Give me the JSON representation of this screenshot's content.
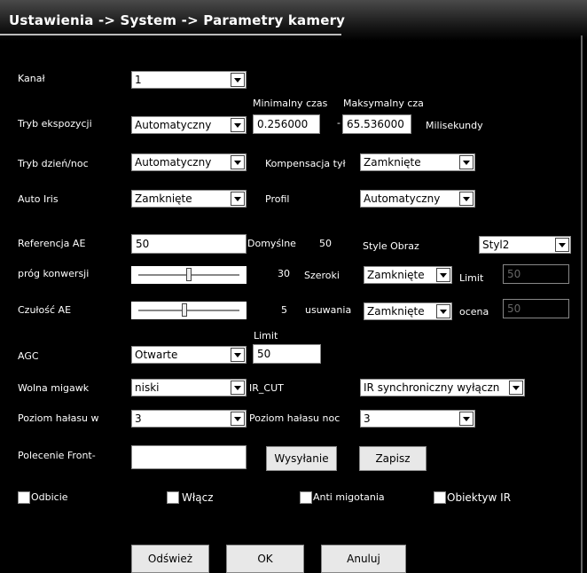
{
  "title": "Ustawienia -> System -> Parametry kamery",
  "labels": {
    "kanal": "Kanał",
    "tryb_ekspozycji": "Tryb ekspozycji",
    "min_czas": "Minimalny czas",
    "max_czas": "Maksymalny cza",
    "milisekundy": "Milisekundy",
    "dash": "-",
    "tryb_dzien_noc": "Tryb dzień/noc",
    "kompensacja": "Kompensacja tył",
    "auto_iris": "Auto Iris",
    "profil": "Profil",
    "referencja_ae": "Referencja AE",
    "domyslne": "Domyślne",
    "domyslne_val": "50",
    "style_obraz": "Style Obraz",
    "prog_konwersji": "próg konwersji",
    "prog_val": "30",
    "szeroki": "Szeroki",
    "limit": "Limit",
    "czulosc_ae": "Czułość AE",
    "czulosc_val": "5",
    "usuwania": "usuwania",
    "ocena": "ocena",
    "agc": "AGC",
    "agc_limit": "Limit",
    "wolna_migawka": "Wolna migawk",
    "ir_cut": "IR_CUT",
    "poziom_halasu_w": "Poziom hałasu w",
    "poziom_halasu_noc": "Poziom hałasu noc",
    "polecenie_front": "Polecenie Front-"
  },
  "fields": {
    "kanal": "1",
    "tryb_ekspozycji": "Automatyczny",
    "min_czas": "0.256000",
    "max_czas": "65.536000",
    "tryb_dzien_noc": "Automatyczny",
    "kompensacja": "Zamknięte",
    "auto_iris": "Zamknięte",
    "profil": "Automatyczny",
    "referencja_ae": "50",
    "style_obraz": "Styl2",
    "szeroki": "Zamknięte",
    "szeroki_limit": "50",
    "usuwania": "Zamknięte",
    "ocena": "50",
    "agc": "Otwarte",
    "agc_limit": "50",
    "wolna_migawka": "niski",
    "ir_cut": "IR synchroniczny wyłączn",
    "poziom_halasu_w": "3",
    "poziom_halasu_noc": "3",
    "polecenie_front": ""
  },
  "sliders": {
    "prog_konwersji": 0.5,
    "czulosc_ae": 0.45
  },
  "buttons": {
    "wysylanie": "Wysyłanie",
    "zapisz": "Zapisz",
    "odswiez": "Odśwież",
    "ok": "OK",
    "anuluj": "Anuluj"
  },
  "checkboxes": {
    "odbicie": "Odbicie",
    "wlacz": "Włącz",
    "anti_migotania": "Anti migotania",
    "obiektyw_ir": "Obiektyw IR"
  }
}
